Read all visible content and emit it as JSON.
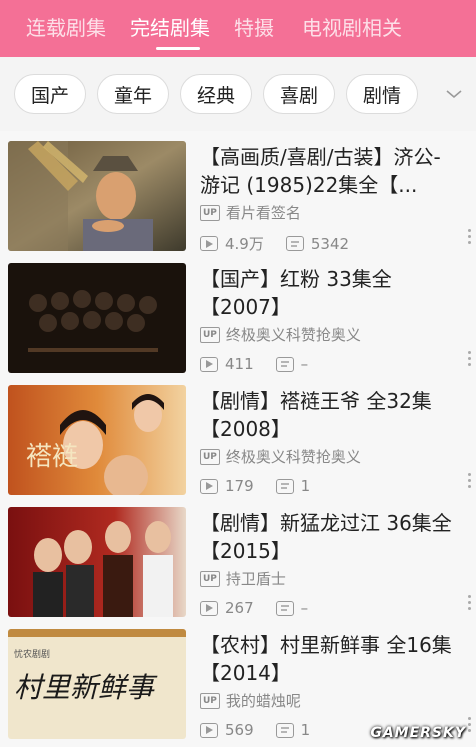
{
  "tabs": [
    {
      "label": "连载剧集",
      "active": false
    },
    {
      "label": "完结剧集",
      "active": true
    },
    {
      "label": "特摄",
      "active": false
    },
    {
      "label": "电视剧相关",
      "active": false
    }
  ],
  "filters": [
    "国产",
    "童年",
    "经典",
    "喜剧",
    "剧情"
  ],
  "items": [
    {
      "title": "【高画质/喜剧/古装】济公-游记 (1985)22集全【...",
      "up": "看片看签名",
      "plays": "4.9万",
      "comments": "5342"
    },
    {
      "title": "【国产】红粉 33集全【2007】",
      "up": "终极奥义科赞抢奥义",
      "plays": "411",
      "comments": "–"
    },
    {
      "title": "【剧情】褡裢王爷 全32集【2008】",
      "up": "终极奥义科赞抢奥义",
      "plays": "179",
      "comments": "1"
    },
    {
      "title": "【剧情】新猛龙过江 36集全【2015】",
      "up": "持卫盾士",
      "plays": "267",
      "comments": "–"
    },
    {
      "title": "【农村】村里新鲜事 全16集【2014】",
      "up": "我的蜡烛呢",
      "plays": "569",
      "comments": "1"
    }
  ],
  "up_badge": "UP",
  "thumb_texts": {
    "item3": "褡裢",
    "item5_main": "村里新鲜事",
    "item5_small": "忧农剧剧"
  },
  "watermark": "GAMERSKY",
  "colors": {
    "accent": "#f47096"
  }
}
